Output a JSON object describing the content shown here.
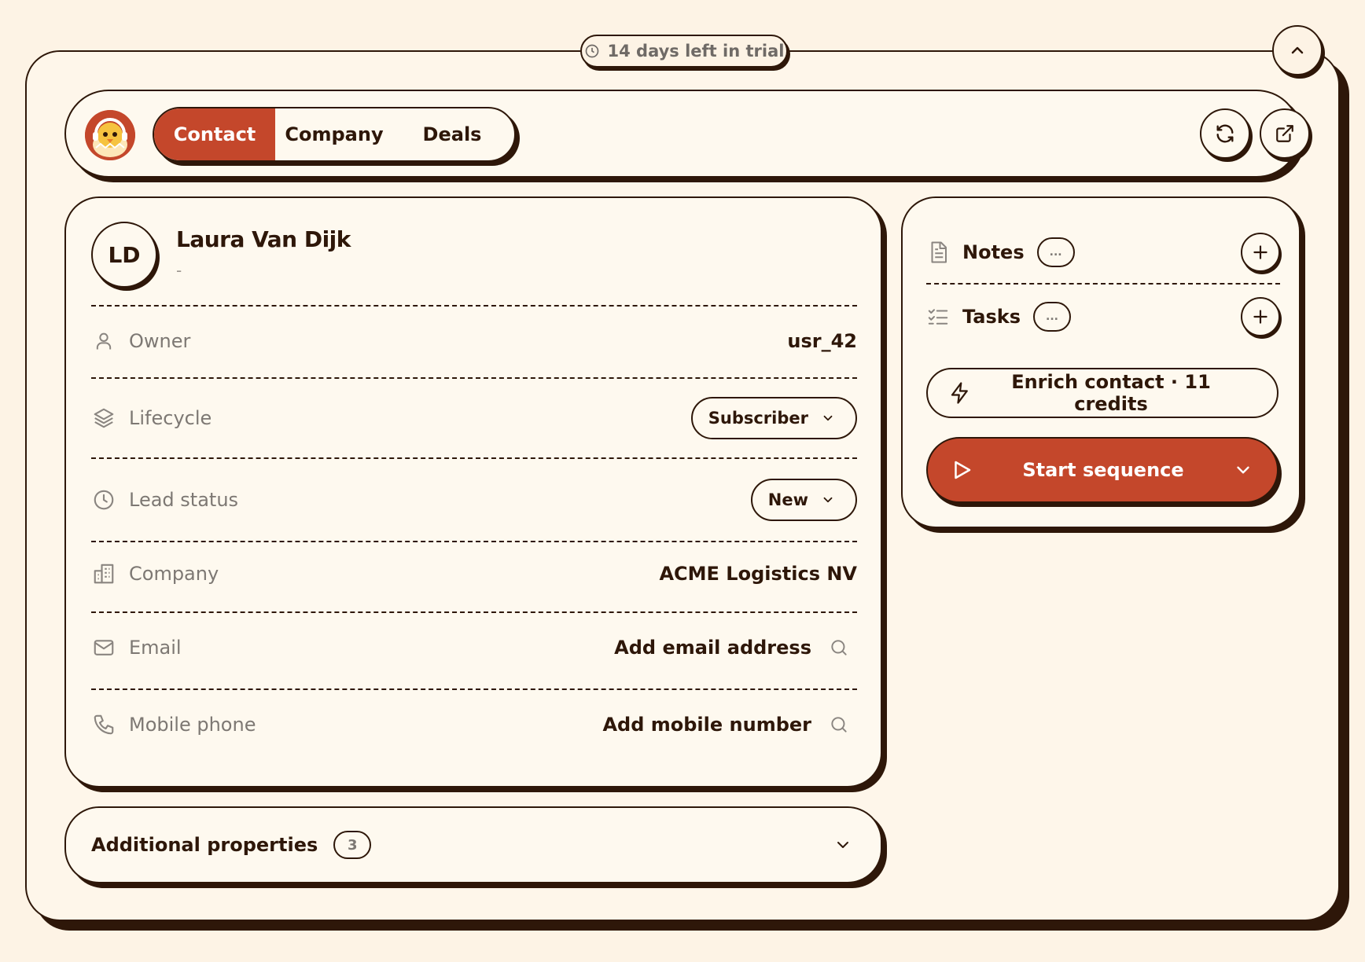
{
  "trial": {
    "text": "14 days left in trial"
  },
  "header": {
    "tabs": [
      {
        "label": "Contact",
        "active": true
      },
      {
        "label": "Company",
        "active": false
      },
      {
        "label": "Deals",
        "active": false
      }
    ]
  },
  "contact": {
    "initials": "LD",
    "name": "Laura Van Dijk",
    "subtitle": "-",
    "fields": {
      "owner": {
        "label": "Owner",
        "value": "usr_42"
      },
      "lifecycle": {
        "label": "Lifecycle",
        "value": "Subscriber"
      },
      "lead_status": {
        "label": "Lead status",
        "value": "New"
      },
      "company": {
        "label": "Company",
        "value": "ACME Logistics NV"
      },
      "email": {
        "label": "Email",
        "value": "Add email address"
      },
      "mobile": {
        "label": "Mobile phone",
        "value": "Add mobile number"
      }
    }
  },
  "additional": {
    "title": "Additional properties",
    "count": "3"
  },
  "side": {
    "notes": {
      "label": "Notes",
      "badge": "..."
    },
    "tasks": {
      "label": "Tasks",
      "badge": "..."
    },
    "enrich": {
      "label": "Enrich contact · 11 credits"
    },
    "start": {
      "label": "Start sequence"
    }
  },
  "colors": {
    "accent": "#c4472b",
    "ink": "#2e1709",
    "background": "#fdf3e5",
    "muted": "#7d7873"
  }
}
